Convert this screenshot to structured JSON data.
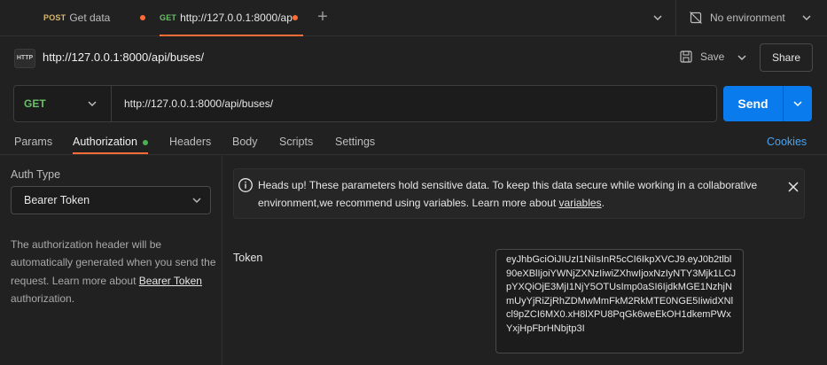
{
  "tabs": [
    {
      "method": "POST",
      "name": "Get data"
    },
    {
      "method": "GET",
      "name": "http://127.0.0.1:8000/ap"
    }
  ],
  "environment": {
    "label": "No environment"
  },
  "request": {
    "title": "http://127.0.0.1:8000/api/buses/",
    "method": "GET",
    "url": "http://127.0.0.1:8000/api/buses/",
    "save_label": "Save",
    "share_label": "Share",
    "send_label": "Send",
    "icon_text": "HTTP"
  },
  "request_tabs": {
    "params": "Params",
    "authorization": "Authorization",
    "headers": "Headers",
    "body": "Body",
    "scripts": "Scripts",
    "settings": "Settings",
    "cookies": "Cookies"
  },
  "auth": {
    "type_label": "Auth Type",
    "selected_type": "Bearer Token",
    "desc_text": "The authorization header will be automatically generated when you send the request. Learn more about",
    "desc_link": "Bearer Token",
    "desc_suffix": "authorization."
  },
  "notice": {
    "text": "Heads up! These parameters hold sensitive data. To keep this data secure while working in a collaborative environment,we recommend using variables. Learn more about",
    "link": "variables",
    "suffix": "."
  },
  "token": {
    "label": "Token",
    "value": "eyJhbGciOiJIUzI1NiIsInR5cCI6IkpXVCJ9.eyJ0b2tlbl90eXBlIjoiYWNjZXNzIiwiZXhwIjoxNzIyNTY3Mjk1LCJpYXQiOjE3MjI1NjY5OTUsImp0aSI6IjdkMGE1NzhjNmUyYjRiZjRhZDMwMmFkM2RkMTE0NGE5IiwidXNlcl9pZCI6MX0.xH8lXPU8PqGk6weEkOH1dkemPWxYxjHpFbrHNbjtp3I"
  },
  "colors": {
    "accent": "#ff6c37",
    "send": "#097bed",
    "get": "#6bbf6b",
    "post": "#d9b86a",
    "link": "#4aa3f0"
  }
}
